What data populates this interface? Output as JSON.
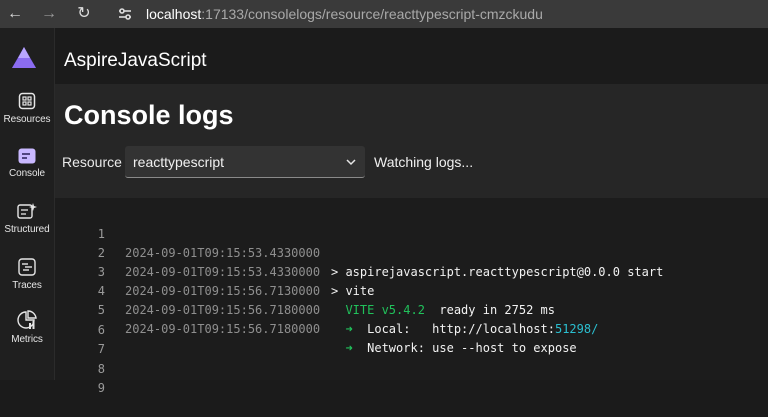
{
  "browser": {
    "url_host": "localhost",
    "url_rest": ":17133/consolelogs/resource/reacttypescript-cmzckudu"
  },
  "app": {
    "title": "AspireJavaScript"
  },
  "rail": {
    "items": [
      {
        "label": "Resources",
        "icon": "resources-icon"
      },
      {
        "label": "Console",
        "icon": "console-icon"
      },
      {
        "label": "Structured",
        "icon": "structured-icon"
      },
      {
        "label": "Traces",
        "icon": "traces-icon"
      },
      {
        "label": "Metrics",
        "icon": "metrics-icon"
      }
    ]
  },
  "page": {
    "title": "Console logs",
    "resource_label": "Resource",
    "resource_value": "reacttypescript",
    "status": "Watching logs..."
  },
  "colors": {
    "accent_green": "#21c15b",
    "accent_cyan": "#2bbfd0",
    "logo_purple": "#8b6cf0"
  },
  "logs": [
    {
      "n": "1",
      "ts": "2024-09-01T09:15:53.4330000",
      "msg": "> aspirejavascript.reacttypescript@0.0.0 start"
    },
    {
      "n": "2",
      "ts": "2024-09-01T09:15:53.4330000",
      "msg": "> vite"
    },
    {
      "n": "3",
      "ts": "2024-09-01T09:15:56.7130000",
      "vite": "VITE v5.4.2",
      "msg": "  ready in 2752 ms"
    },
    {
      "n": "4",
      "ts": "2024-09-01T09:15:56.7180000",
      "arrow": "➜",
      "msg": "  Local:   http://localhost:",
      "port": "51298",
      "tail": "/"
    },
    {
      "n": "5",
      "ts": "2024-09-01T09:15:56.7180000",
      "arrow": "➜",
      "msg": "  Network: use --host to expose"
    },
    {
      "n": "6"
    },
    {
      "n": "7"
    },
    {
      "n": "8"
    },
    {
      "n": "9"
    }
  ]
}
